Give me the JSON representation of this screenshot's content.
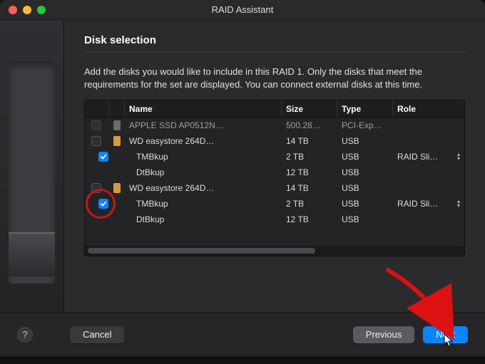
{
  "window": {
    "title": "RAID Assistant"
  },
  "section": {
    "title": "Disk selection"
  },
  "description": "Add the disks you would like to include in this RAID 1. Only the disks that meet the requirements for the set are displayed. You can connect external disks at this time.",
  "table": {
    "headers": {
      "name": "Name",
      "size": "Size",
      "type": "Type",
      "role": "Role"
    },
    "rows": [
      {
        "indent": 1,
        "checkbox": "placeholder",
        "icon": "gray",
        "name": "APPLE SSD AP0512N…",
        "size": "500.28…",
        "type": "PCI-Exp…",
        "role": "",
        "dim": true
      },
      {
        "indent": 1,
        "checkbox": "mixed",
        "icon": "orange",
        "name": "WD easystore 264D…",
        "size": "14 TB",
        "type": "USB",
        "role": ""
      },
      {
        "indent": 2,
        "checkbox": "checked",
        "icon": "",
        "name": "TMBkup",
        "size": "2 TB",
        "type": "USB",
        "role": "RAID Sli…",
        "has_stepper": true
      },
      {
        "indent": 2,
        "checkbox": "none",
        "icon": "",
        "name": "DtBkup",
        "size": "12 TB",
        "type": "USB",
        "role": ""
      },
      {
        "indent": 1,
        "checkbox": "mixed",
        "icon": "orange",
        "name": "WD easystore 264D…",
        "size": "14 TB",
        "type": "USB",
        "role": ""
      },
      {
        "indent": 2,
        "checkbox": "checked",
        "icon": "",
        "name": "TMBkup",
        "size": "2 TB",
        "type": "USB",
        "role": "RAID Sli…",
        "has_stepper": true,
        "annot_circle": true
      },
      {
        "indent": 2,
        "checkbox": "none",
        "icon": "",
        "name": "DtBkup",
        "size": "12 TB",
        "type": "USB",
        "role": ""
      }
    ]
  },
  "buttons": {
    "help": "?",
    "cancel": "Cancel",
    "previous": "Previous",
    "next": "Next"
  }
}
